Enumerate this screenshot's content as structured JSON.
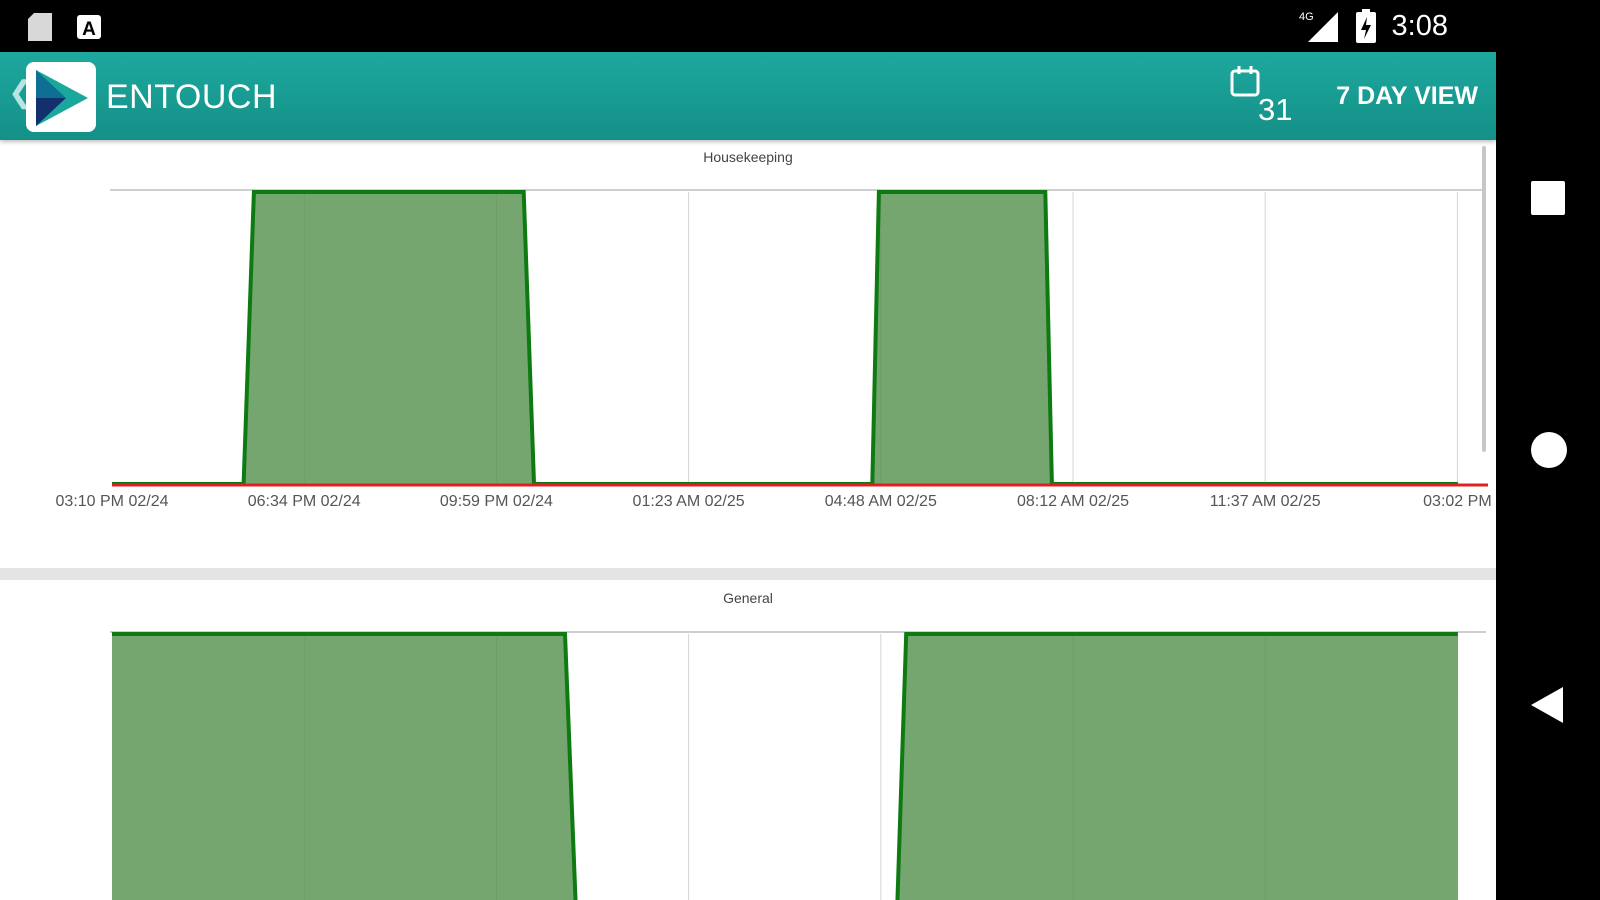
{
  "status_bar": {
    "time": "3:08",
    "network": "4G",
    "left_icons": [
      "sd-card-icon",
      "auto-a-icon"
    ],
    "right_icons": [
      "signal-icon",
      "battery-icon"
    ]
  },
  "app_bar": {
    "title": "ENTOUCH",
    "calendar_day": "31",
    "view_button": "7 DAY VIEW",
    "color": "#17a095"
  },
  "nav_bar": {
    "buttons": [
      "recents-square-icon",
      "home-circle-icon",
      "back-triangle-icon"
    ]
  },
  "colors": {
    "fill": "#76a670",
    "stroke": "#0d7a12",
    "baseline": "#e02020",
    "grid": "#e3e3e3"
  },
  "chart_data": [
    {
      "type": "area",
      "title": "Housekeeping",
      "x_tick_labels": [
        "03:10 PM 02/24",
        "06:34 PM 02/24",
        "09:59 PM 02/24",
        "01:23 AM 02/25",
        "04:48 AM 02/25",
        "08:12 AM 02/25",
        "11:37 AM 02/25",
        "03:02 PM"
      ],
      "x": [
        "03:10 PM 02/24",
        "05:30 PM 02/24",
        "05:41 PM 02/24",
        "10:28 PM 02/24",
        "10:39 PM 02/24",
        "04:39 AM 02/25",
        "04:46 AM 02/25",
        "07:43 AM 02/25",
        "07:50 AM 02/25",
        "03:02 PM 02/25"
      ],
      "values": [
        0,
        0,
        1,
        1,
        0,
        0,
        1,
        1,
        0,
        0
      ]
    },
    {
      "type": "area",
      "title": "General",
      "x": [
        "03:10 PM 02/24",
        "11:12 PM 02/24",
        "11:24 PM 02/24",
        "05:05 AM 02/25",
        "05:15 AM 02/25",
        "03:02 PM 02/25"
      ],
      "values": [
        1,
        1,
        0,
        0,
        1,
        1
      ]
    }
  ]
}
